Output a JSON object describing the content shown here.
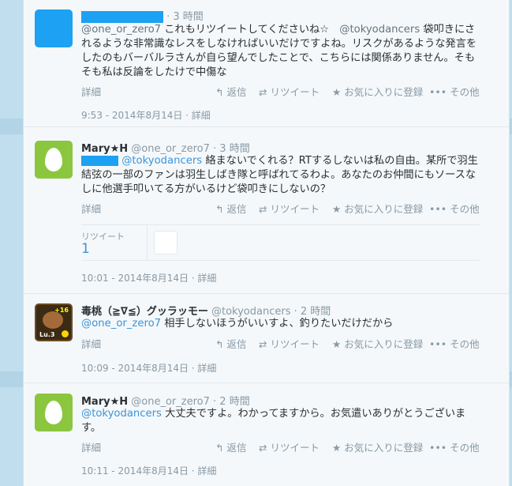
{
  "actions": {
    "detail": "詳細",
    "reply": "返信",
    "retweet": "リツイート",
    "favorite": "お気に入りに登録",
    "more": "その他"
  },
  "tweets": [
    {
      "time": "· 3 時間",
      "mention1": "@one_or_zero7",
      "text1": " これもリツイートしてくださいね☆　",
      "mention2": "@tokyodancers",
      "text2": " 袋叩きにされるような非常識なレスをしなければいいだけですよね。リスクがあるような発言をしたのもバーバルラさんが自ら望んでしたことで、こちらには関係ありません。そもそも私は反論をしたけで中傷な",
      "meta": "9:53 - 2014年8月14日 · 詳細"
    },
    {
      "name": "Mary★H",
      "handle": "@one_or_zero7",
      "time": "· 3 時間",
      "mention": "@tokyodancers",
      "text": " 絡まないでくれる？RTするしないは私の自由。某所で羽生結弦の一部のファンは羽生しばき隊と呼ばれてるわよ。あなたのお仲間にもソースなしに他選手叩いてる方がいるけど袋叩きにしないの？",
      "retweets_label": "リツイート",
      "retweets_count": "1",
      "meta": "10:01 - 2014年8月14日 · 詳細"
    },
    {
      "name": "毒桃（≧∇≦）グッラッモー",
      "handle": "@tokyodancers",
      "time": "· 2 時間",
      "avatar_plus": "+16",
      "avatar_level": "Lu.3",
      "mention": "@one_or_zero7",
      "text": " 相手しないほうがいいすよ、釣りたいだけだから",
      "meta": "10:09 - 2014年8月14日 · 詳細"
    },
    {
      "name": "Mary★H",
      "handle": "@one_or_zero7",
      "time": "· 2 時間",
      "mention": "@tokyodancers",
      "text": " 大丈夫ですよ。わかってますから。お気遣いありがとうございます。",
      "meta": "10:11 - 2014年8月14日 · 詳細"
    }
  ]
}
